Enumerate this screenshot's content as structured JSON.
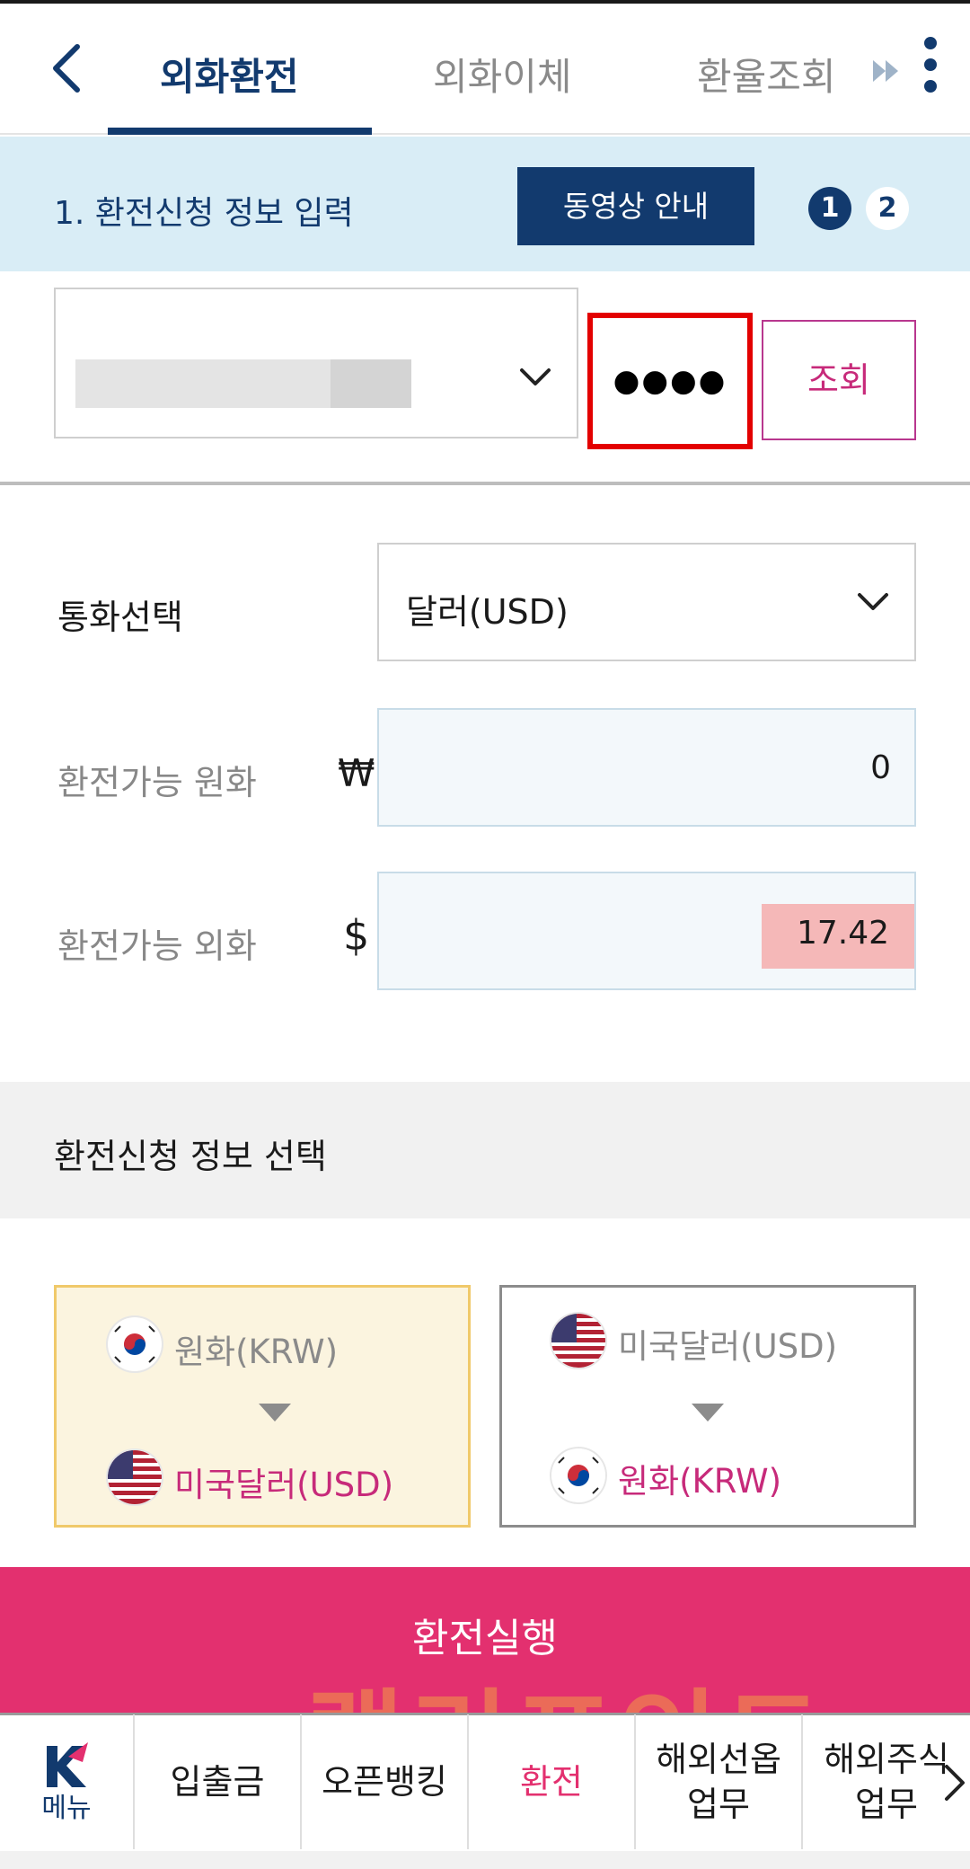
{
  "header": {
    "tabs": [
      {
        "label": "외화환전",
        "active": true
      },
      {
        "label": "외화이체",
        "active": false
      },
      {
        "label": "환율조회",
        "active": false
      }
    ]
  },
  "step": {
    "title": "1. 환전신청 정보 입력",
    "video_button": "동영상 안내",
    "steps": [
      "1",
      "2"
    ],
    "current": "1"
  },
  "account": {
    "password_mask": "●●●●",
    "query_button": "조회"
  },
  "form": {
    "currency_label": "통화선택",
    "currency_value": "달러(USD)",
    "krw_label": "환전가능 원화",
    "krw_symbol": "₩",
    "krw_value": "0",
    "fx_label": "환전가능 외화",
    "fx_symbol": "$",
    "fx_value": "17.42"
  },
  "section2": {
    "title": "환전신청 정보 선택"
  },
  "options": [
    {
      "from": "원화(KRW)",
      "to": "미국달러(USD)",
      "selected": true
    },
    {
      "from": "미국달러(USD)",
      "to": "원화(KRW)",
      "selected": false
    }
  ],
  "execute_button": "환전실행",
  "watermark": "랠리포인트",
  "bottom_nav": {
    "menu_label": "메뉴",
    "items": [
      {
        "label": "입출금",
        "active": false
      },
      {
        "label": "오픈뱅킹",
        "active": false
      },
      {
        "label": "환전",
        "active": true
      },
      {
        "label1": "해외선옵",
        "label2": "업무",
        "active": false
      },
      {
        "label1": "해외주식",
        "label2": "업무",
        "active": false
      }
    ]
  },
  "colors": {
    "brand_navy": "#123a6e",
    "accent_pink": "#e3306f",
    "highlight_red": "#e30000"
  }
}
